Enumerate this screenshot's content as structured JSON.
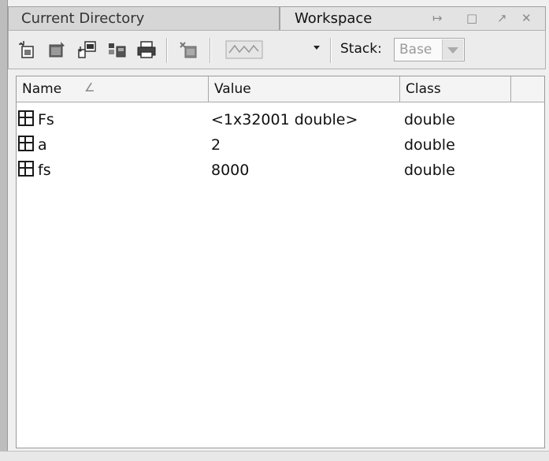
{
  "tabs": [
    {
      "label": "Current Directory",
      "active": false
    },
    {
      "label": "Workspace",
      "active": true
    }
  ],
  "window_controls": {
    "undock": "↦",
    "maximize": "□",
    "restore": "↗",
    "close": "✕"
  },
  "toolbar": {
    "icons": [
      "new-variable-icon",
      "open-selection-icon",
      "import-data-icon",
      "save-workspace-icon",
      "print-icon",
      "delete-icon",
      "plot-icon",
      "plot-dropdown-arrow-icon"
    ],
    "stack_label": "Stack:",
    "stack_value": "Base"
  },
  "table": {
    "columns": [
      "Name",
      "Value",
      "Class"
    ],
    "sort_indicator": "∠",
    "rows": [
      {
        "name": "Fs",
        "value": "<1x32001 double>",
        "class": "double"
      },
      {
        "name": "a",
        "value": "2",
        "class": "double"
      },
      {
        "name": "fs",
        "value": "8000",
        "class": "double"
      }
    ]
  }
}
